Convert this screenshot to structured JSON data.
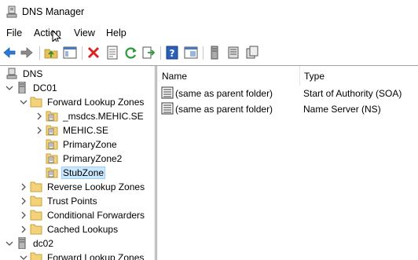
{
  "window": {
    "title": "DNS Manager",
    "icon": "dns-manager-icon"
  },
  "menu": [
    "File",
    "Action",
    "View",
    "Help"
  ],
  "toolbar": [
    "back-arrow-icon",
    "forward-arrow-icon",
    "up-folder-icon",
    "show-hide-tree-icon",
    "delete-icon",
    "properties-icon",
    "refresh-icon",
    "export-list-icon",
    "help-icon",
    "console-icon",
    "server-icon",
    "record-list-icon",
    "new-record-icon"
  ],
  "tree": {
    "root": "DNS",
    "nodes": [
      {
        "label": "DC01"
      },
      {
        "label": "Forward Lookup Zones"
      },
      {
        "label": "_msdcs.MEHIC.SE"
      },
      {
        "label": "MEHIC.SE"
      },
      {
        "label": "PrimaryZone"
      },
      {
        "label": "PrimaryZone2"
      },
      {
        "label": "StubZone"
      },
      {
        "label": "Reverse Lookup Zones"
      },
      {
        "label": "Trust Points"
      },
      {
        "label": "Conditional Forwarders"
      },
      {
        "label": "Cached Lookups"
      },
      {
        "label": "dc02"
      },
      {
        "label": "Forward Lookup Zones"
      }
    ]
  },
  "list": {
    "columns": [
      "Name",
      "Type"
    ],
    "rows": [
      {
        "name": "(same as parent folder)",
        "type": "Start of Authority (SOA)"
      },
      {
        "name": "(same as parent folder)",
        "type": "Name Server (NS)"
      }
    ]
  }
}
